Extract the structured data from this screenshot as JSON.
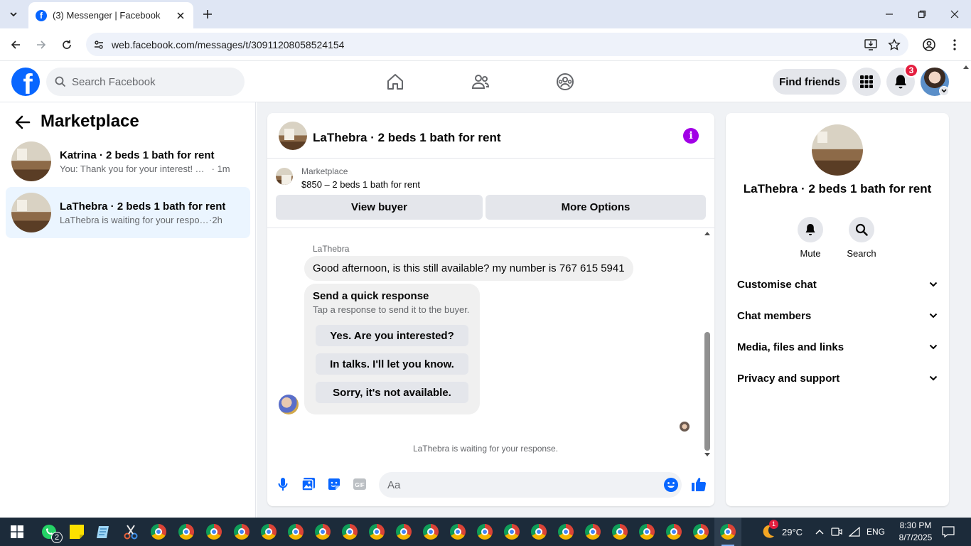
{
  "browser": {
    "tab_title": "(3) Messenger | Facebook",
    "url": "web.facebook.com/messages/t/30911208058524154",
    "icons": [
      "tab-search-icon",
      "close-icon",
      "plus-icon",
      "minimize-icon",
      "restore-icon",
      "close-window-icon",
      "back-icon",
      "forward-icon",
      "reload-icon",
      "site-info-icon",
      "install-icon",
      "star-icon",
      "profile-icon",
      "menu-icon"
    ]
  },
  "fb_header": {
    "search_placeholder": "Search Facebook",
    "find_friends": "Find friends",
    "notification_count": "3",
    "colors": {
      "brand": "#0866ff",
      "badge": "#e41e3f"
    }
  },
  "left_panel": {
    "title": "Marketplace",
    "conversations": [
      {
        "name": "Katrina · 2 beds 1 bath for rent",
        "preview": "You: Thank you for your interest! The ...",
        "time": "1m",
        "active": false
      },
      {
        "name": "LaThebra · 2 beds 1 bath for rent",
        "preview": "LaThebra is waiting for your response.",
        "time": "2h",
        "active": true
      }
    ]
  },
  "chat": {
    "title": "LaThebra · 2 beds 1 bath for rent",
    "listing": {
      "source": "Marketplace",
      "summary": "$850 – 2 beds 1 bath for rent",
      "view_buyer": "View buyer",
      "more_options": "More Options"
    },
    "sender": "LaThebra",
    "message": "Good afternoon, is this still available? my number is 767 615 5941",
    "quick_response": {
      "title": "Send a quick response",
      "subtitle": "Tap a response to send it to the buyer.",
      "options": [
        "Yes. Are you interested?",
        "In talks. I'll let you know.",
        "Sorry, it's not available."
      ]
    },
    "waiting_text": "LaThebra is waiting for your response.",
    "composer_placeholder": "Aa",
    "info_color": "#a100e6"
  },
  "right_panel": {
    "name": "LaThebra · 2 beds 1 bath for rent",
    "actions": [
      "Mute",
      "Search"
    ],
    "sections": [
      "Customise chat",
      "Chat members",
      "Media, files and links",
      "Privacy and support"
    ]
  },
  "taskbar": {
    "whatsapp_count": "2",
    "weather": "29°C",
    "notif_count": "1",
    "language": "ENG",
    "time": "8:30 PM",
    "date": "8/7/2025"
  }
}
